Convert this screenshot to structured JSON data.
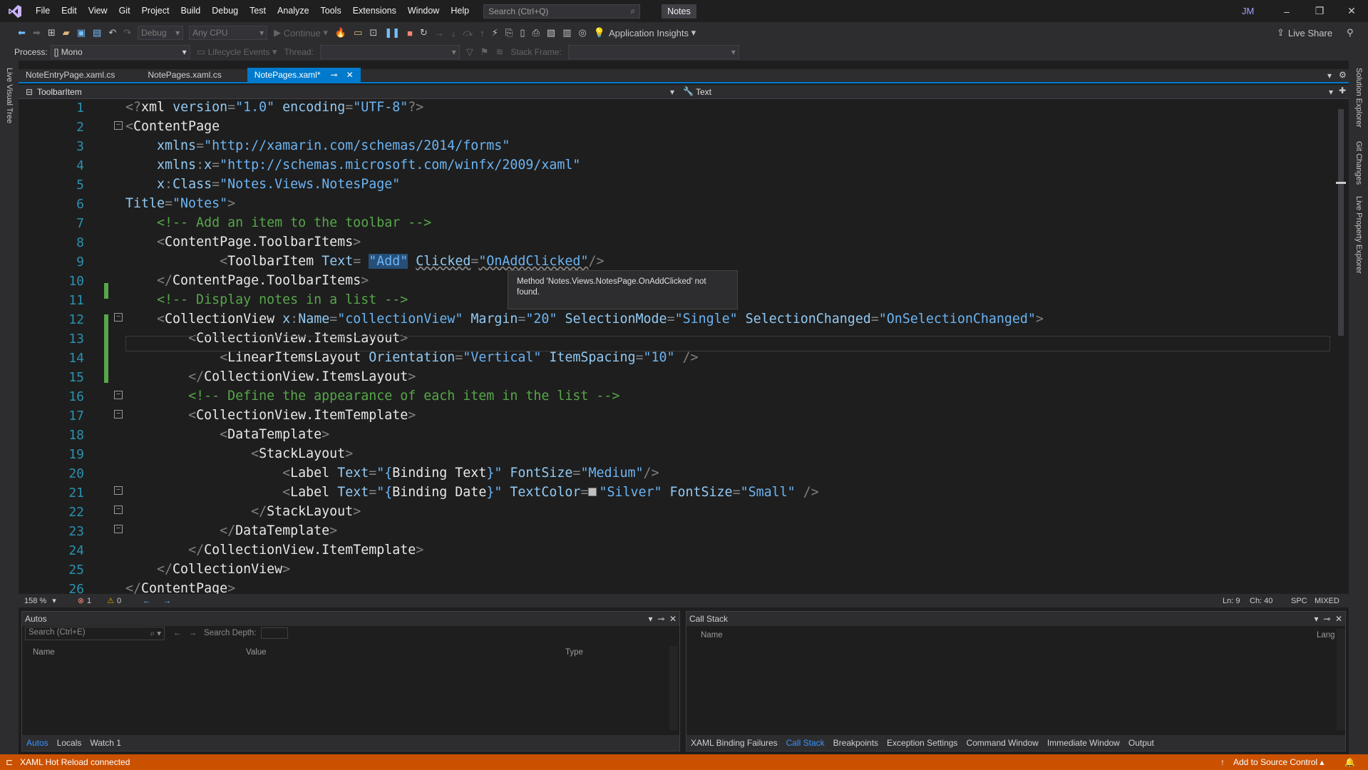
{
  "menu": {
    "items": [
      "File",
      "Edit",
      "View",
      "Git",
      "Project",
      "Build",
      "Debug",
      "Test",
      "Analyze",
      "Tools",
      "Extensions",
      "Window",
      "Help"
    ],
    "search_placeholder": "Search (Ctrl+Q)",
    "solution_name": "Notes",
    "user_initials": "JM"
  },
  "toolbar": {
    "config": "Debug",
    "platform": "Any CPU",
    "continue_label": "Continue",
    "app_insights": "Application Insights",
    "live_share": "Live Share",
    "process_label": "Process:",
    "process_value": "[] Mono",
    "lifecycle_label": "Lifecycle Events",
    "thread_label": "Thread:",
    "stackframe_label": "Stack Frame:"
  },
  "side_tabs": {
    "left": [
      "Live Visual Tree"
    ],
    "right": [
      "Solution Explorer",
      "Git Changes",
      "Live Property Explorer"
    ]
  },
  "doc_tabs": [
    {
      "label": "NoteEntryPage.xaml.cs",
      "active": false
    },
    {
      "label": "NotePages.xaml.cs",
      "active": false
    },
    {
      "label": "NotePages.xaml*",
      "active": true
    }
  ],
  "navbar": {
    "left": "ToolbarItem",
    "right": "Text"
  },
  "code_lines": [
    {
      "n": "1",
      "html": "<span class='p'>&lt;?</span><span class='t'>xml</span> <span class='a'>version</span><span class='p'>=</span><span class='s'>\"1.0\"</span> <span class='a'>encoding</span><span class='p'>=</span><span class='s'>\"UTF-8\"</span><span class='p'>?&gt;</span>"
    },
    {
      "n": "2",
      "html": "<span class='p'>&lt;</span><span class='t'>ContentPage</span>"
    },
    {
      "n": "3",
      "html": "    <span class='a'>xmlns</span><span class='p'>=</span><span class='s'>\"http://xamarin.com/schemas/2014/forms\"</span>"
    },
    {
      "n": "4",
      "html": "    <span class='a'>xmlns</span><span class='p'>:</span><span class='a'>x</span><span class='p'>=</span><span class='s'>\"http://schemas.microsoft.com/winfx/2009/xaml\"</span>"
    },
    {
      "n": "5",
      "html": "    <span class='a'>x</span><span class='p'>:</span><span class='a'>Class</span><span class='p'>=</span><span class='s'>\"Notes.Views.NotesPage\"</span>"
    },
    {
      "n": "6",
      "html": "<span class='a'>Title</span><span class='p'>=</span><span class='s'>\"Notes\"</span><span class='p'>&gt;</span>"
    },
    {
      "n": "7",
      "html": "    <span class='c'>&lt;!-- Add an item to the toolbar --&gt;</span>"
    },
    {
      "n": "8",
      "html": "    <span class='p'>&lt;</span><span class='t'>ContentPage.ToolbarItems</span><span class='p'>&gt;</span>"
    },
    {
      "n": "9",
      "html": "            <span class='p'>&lt;</span><span class='t'>ToolbarItem</span> <span class='a'>Text</span><span class='p'>=</span> <span class='s' style='background:#264f78'>\"Add\"</span> <span class='a' style='text-decoration:underline wavy #888'>Clicked</span><span class='p'>=</span><span class='s' style='text-decoration:underline wavy #888'>\"OnAddClicked\"</span><span class='p'>/&gt;</span>"
    },
    {
      "n": "10",
      "html": "    <span class='p'>&lt;/</span><span class='t'>ContentPage.ToolbarItems</span><span class='p'>&gt;</span>"
    },
    {
      "n": "11",
      "html": "    <span class='c'>&lt;!-- Display notes in a list --&gt;</span>"
    },
    {
      "n": "12",
      "html": "    <span class='p'>&lt;</span><span class='t'>CollectionView</span> <span class='a'>x</span><span class='p'>:</span><span class='a'>Name</span><span class='p'>=</span><span class='s'>\"collectionView\"</span> <span class='a'>Margin</span><span class='p'>=</span><span class='s'>\"20\"</span> <span class='a'>SelectionMode</span><span class='p'>=</span><span class='s'>\"Single\"</span> <span class='a'>SelectionChanged</span><span class='p'>=</span><span class='s'>\"OnSelectionChanged\"</span><span class='p'>&gt;</span>"
    },
    {
      "n": "13",
      "html": "        <span class='p'>&lt;</span><span class='t'>CollectionView.ItemsLayout</span><span class='p'>&gt;</span>"
    },
    {
      "n": "14",
      "html": "            <span class='p'>&lt;</span><span class='t'>LinearItemsLayout</span> <span class='a'>Orientation</span><span class='p'>=</span><span class='s'>\"Vertical\"</span> <span class='a'>ItemSpacing</span><span class='p'>=</span><span class='s'>\"10\"</span> <span class='p'>/&gt;</span>"
    },
    {
      "n": "15",
      "html": "        <span class='p'>&lt;/</span><span class='t'>CollectionView.ItemsLayout</span><span class='p'>&gt;</span>"
    },
    {
      "n": "16",
      "html": "        <span class='c'>&lt;!-- Define the appearance of each item in the list --&gt;</span>"
    },
    {
      "n": "17",
      "html": "        <span class='p'>&lt;</span><span class='t'>CollectionView.ItemTemplate</span><span class='p'>&gt;</span>"
    },
    {
      "n": "18",
      "html": "            <span class='p'>&lt;</span><span class='t'>DataTemplate</span><span class='p'>&gt;</span>"
    },
    {
      "n": "19",
      "html": "                <span class='p'>&lt;</span><span class='t'>StackLayout</span><span class='p'>&gt;</span>"
    },
    {
      "n": "20",
      "html": "                    <span class='p'>&lt;</span><span class='t'>Label</span> <span class='a'>Text</span><span class='p'>=</span><span class='s'>\"{</span><span class='n'>Binding Text</span><span class='s'>}\"</span> <span class='a'>FontSize</span><span class='p'>=</span><span class='s'>\"Medium\"</span><span class='p'>/&gt;</span>"
    },
    {
      "n": "21",
      "html": "                    <span class='p'>&lt;</span><span class='t'>Label</span> <span class='a'>Text</span><span class='p'>=</span><span class='s'>\"{</span><span class='n'>Binding Date</span><span class='s'>}\"</span> <span class='a'>TextColor</span><span class='p'>=</span><span style='display:inline-block;width:12px;height:12px;background:#c0c0c0;border:1px solid #777;margin-right:3px'></span><span class='s'>\"Silver\"</span> <span class='a'>FontSize</span><span class='p'>=</span><span class='s'>\"Small\"</span> <span class='p'>/&gt;</span>"
    },
    {
      "n": "22",
      "html": "                <span class='p'>&lt;/</span><span class='t'>StackLayout</span><span class='p'>&gt;</span>"
    },
    {
      "n": "23",
      "html": "            <span class='p'>&lt;/</span><span class='t'>DataTemplate</span><span class='p'>&gt;</span>"
    },
    {
      "n": "24",
      "html": "        <span class='p'>&lt;/</span><span class='t'>CollectionView.ItemTemplate</span><span class='p'>&gt;</span>"
    },
    {
      "n": "25",
      "html": "    <span class='p'>&lt;/</span><span class='t'>CollectionView</span><span class='p'>&gt;</span>"
    },
    {
      "n": "26",
      "html": "<span class='p'>&lt;/</span><span class='t'>ContentPage</span><span class='p'>&gt;</span>"
    }
  ],
  "tooltip": "Method 'Notes.Views.NotesPage.OnAddClicked' not found.",
  "editor_status": {
    "zoom": "158 %",
    "errors": "1",
    "warnings": "0",
    "line": "Ln: 9",
    "col": "Ch: 40",
    "spc": "SPC",
    "eol": "MIXED"
  },
  "autos": {
    "title": "Autos",
    "search_placeholder": "Search (Ctrl+E)",
    "depth_label": "Search Depth:",
    "columns": [
      "Name",
      "Value",
      "Type"
    ],
    "tabs": [
      "Autos",
      "Locals",
      "Watch 1"
    ]
  },
  "callstack": {
    "title": "Call Stack",
    "columns": [
      "Name",
      "Lang"
    ],
    "tabs": [
      "XAML Binding Failures",
      "Call Stack",
      "Breakpoints",
      "Exception Settings",
      "Command Window",
      "Immediate Window",
      "Output"
    ]
  },
  "statusbar": {
    "left": "XAML Hot Reload connected",
    "right": "Add to Source Control"
  },
  "colors": {
    "accent": "#007acc",
    "status": "#ca5100"
  }
}
